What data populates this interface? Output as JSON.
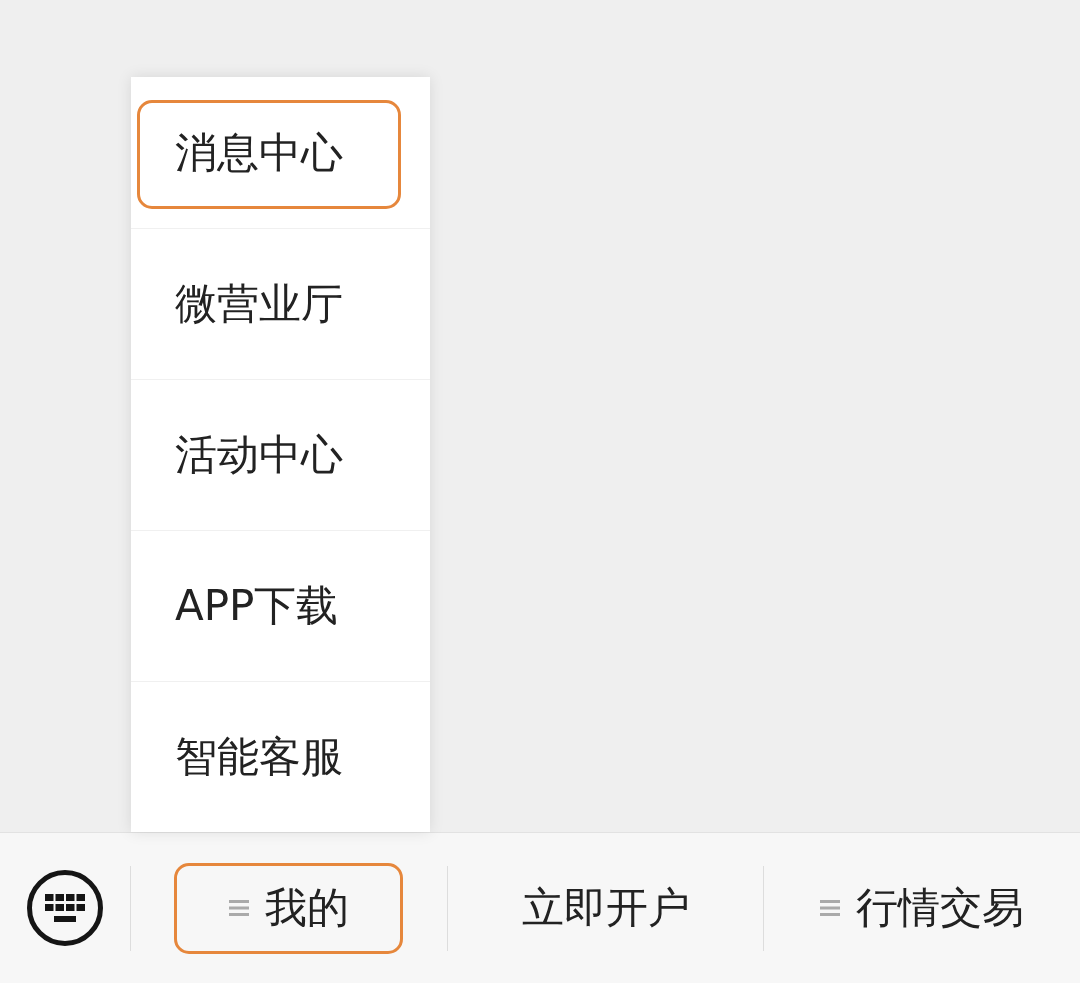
{
  "popup_menu": {
    "items": [
      {
        "label": "消息中心",
        "highlighted": true
      },
      {
        "label": "微营业厅",
        "highlighted": false
      },
      {
        "label": "活动中心",
        "highlighted": false
      },
      {
        "label": "APP下载",
        "highlighted": false
      },
      {
        "label": "智能客服",
        "highlighted": false
      }
    ]
  },
  "bottom_bar": {
    "tabs": [
      {
        "label": "我的",
        "kind": "menu",
        "highlighted": true
      },
      {
        "label": "立即开户",
        "kind": "link",
        "highlighted": false
      },
      {
        "label": "行情交易",
        "kind": "menu",
        "highlighted": false
      }
    ]
  }
}
